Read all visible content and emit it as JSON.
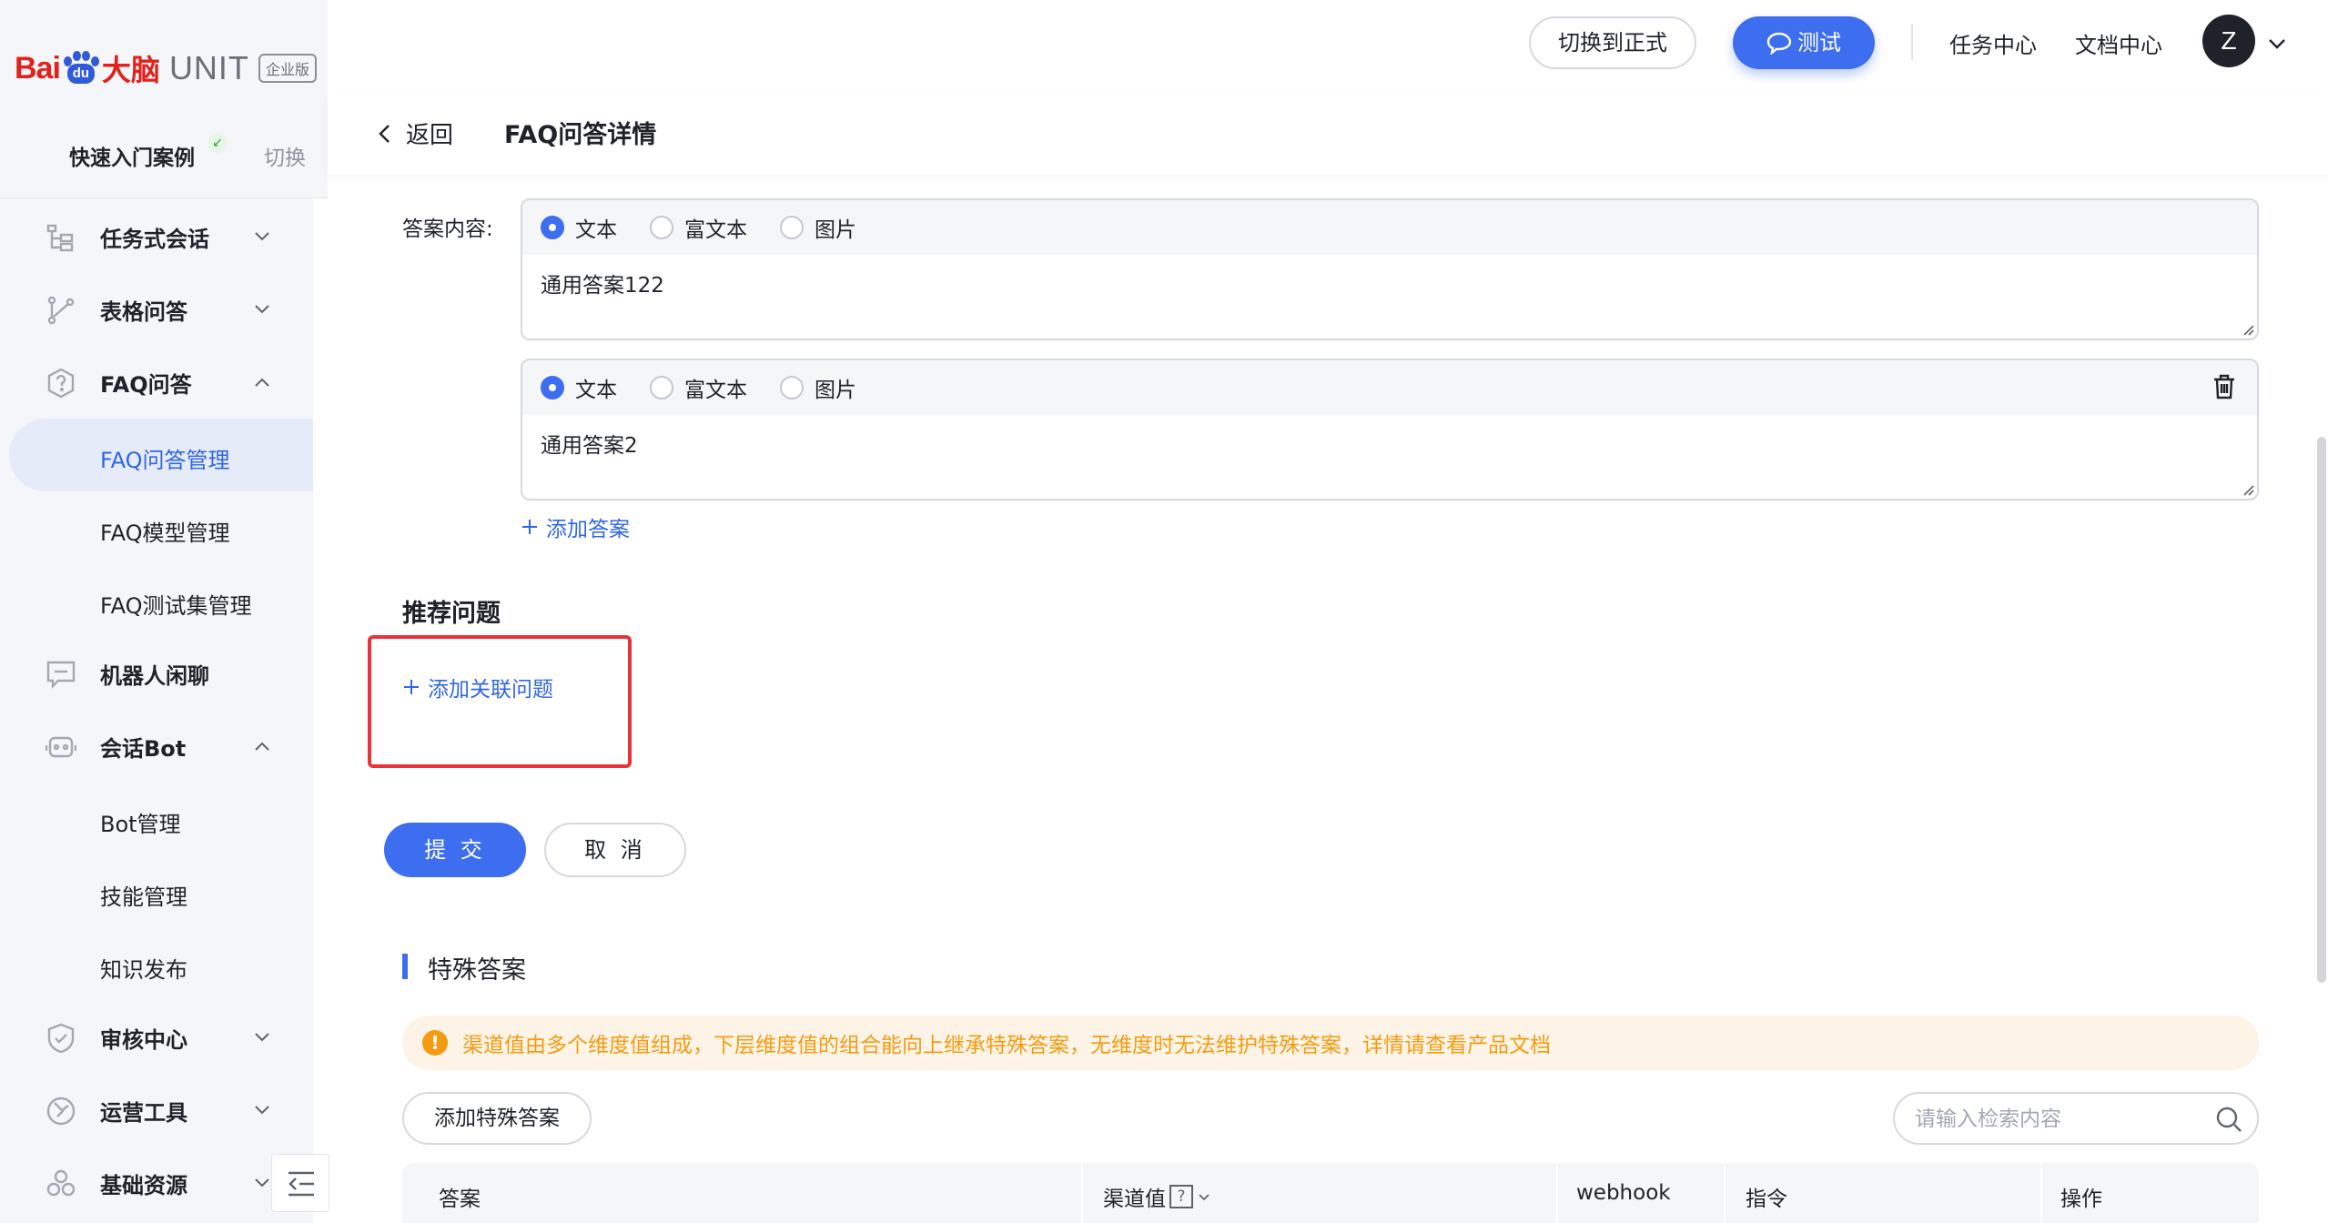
{
  "logo": {
    "bai": "Bai",
    "du": "du",
    "brain": "大脑",
    "unit": "UNIT",
    "edition": "企业版"
  },
  "case": {
    "name": "快速入门案例",
    "switch": "切换"
  },
  "sidebar": {
    "items": [
      {
        "label": "任务式会话",
        "icon": "flow-icon",
        "expanded": false
      },
      {
        "label": "表格问答",
        "icon": "branch-icon",
        "expanded": false
      },
      {
        "label": "FAQ问答",
        "icon": "question-shield-icon",
        "expanded": true,
        "children": [
          "FAQ问答管理",
          "FAQ模型管理",
          "FAQ测试集管理"
        ],
        "active_child": "FAQ问答管理"
      },
      {
        "label": "机器人闲聊",
        "icon": "chat-icon",
        "expanded": null
      },
      {
        "label": "会话Bot",
        "icon": "bot-icon",
        "expanded": true,
        "children": [
          "Bot管理",
          "技能管理",
          "知识发布"
        ]
      },
      {
        "label": "审核中心",
        "icon": "shield-check-icon",
        "expanded": false
      },
      {
        "label": "运营工具",
        "icon": "tool-icon",
        "expanded": false
      },
      {
        "label": "基础资源",
        "icon": "resource-icon",
        "expanded": false
      }
    ]
  },
  "header": {
    "switch_formal": "切换到正式",
    "test": "测试",
    "task_center": "任务中心",
    "doc_center": "文档中心",
    "avatar": "Z"
  },
  "subheader": {
    "back": "返回",
    "title": "FAQ问答详情"
  },
  "form": {
    "answer_label": "答案内容:",
    "answer_types": [
      "文本",
      "富文本",
      "图片"
    ],
    "answers": [
      {
        "type": "文本",
        "text": "通用答案122",
        "deletable": false
      },
      {
        "type": "文本",
        "text": "通用答案2",
        "deletable": true
      }
    ],
    "add_answer": "添加答案",
    "recommend_title": "推荐问题",
    "add_related": "添加关联问题",
    "submit": "提 交",
    "cancel": "取 消"
  },
  "special": {
    "title": "特殊答案",
    "notice": "渠道值由多个维度值组成，下层维度值的组合能向上继承特殊答案，无维度时无法维护特殊答案，详情请查看产品文档",
    "add_button": "添加特殊答案",
    "search_placeholder": "请输入检索内容",
    "columns": [
      "答案",
      "渠道值",
      "webhook",
      "指令",
      "操作"
    ],
    "help_mark": "?"
  },
  "colors": {
    "primary": "#3d6ef0",
    "warning": "#f39c12",
    "highlight": "#e8333a",
    "brand_red": "#e0221b"
  }
}
